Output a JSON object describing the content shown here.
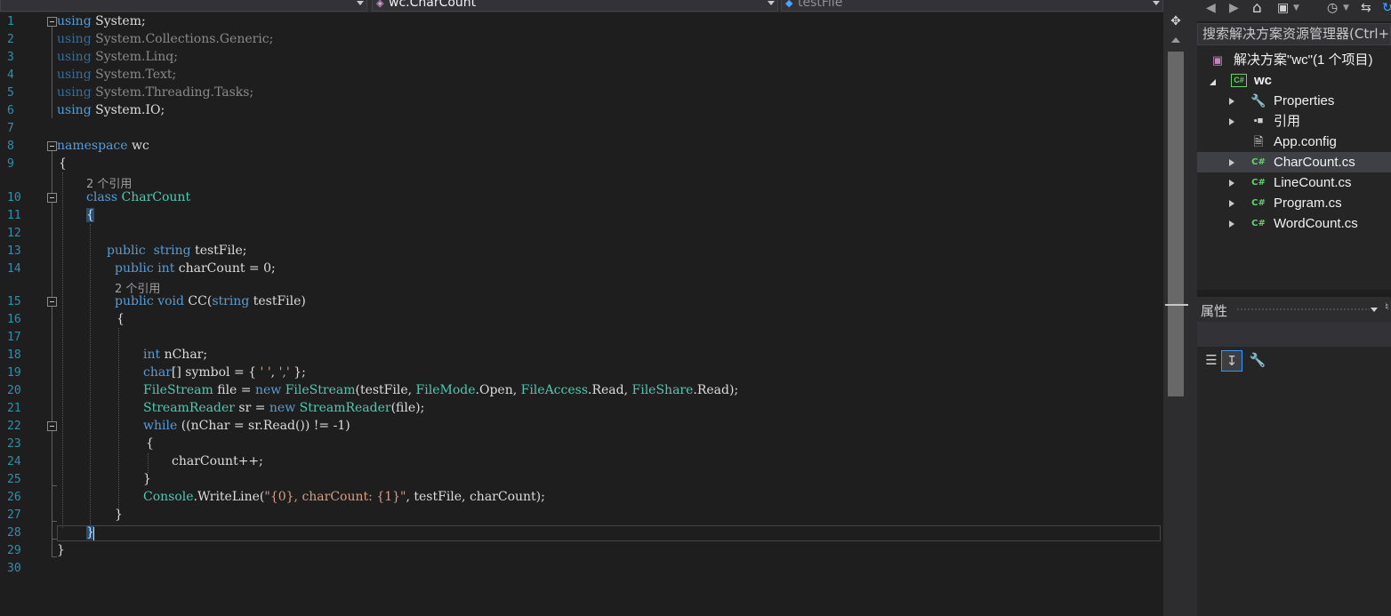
{
  "nav": {
    "project_dropdown": "",
    "class_dropdown": "wc.CharCount",
    "member_dropdown": "testFile"
  },
  "code_lines": [
    {
      "n": "1",
      "text": "using System;"
    },
    {
      "n": "2",
      "text": "using System.Collections.Generic;"
    },
    {
      "n": "3",
      "text": "using System.Linq;"
    },
    {
      "n": "4",
      "text": "using System.Text;"
    },
    {
      "n": "5",
      "text": "using System.Threading.Tasks;"
    },
    {
      "n": "6",
      "text": "using System.IO;"
    },
    {
      "n": "7",
      "text": ""
    },
    {
      "n": "8",
      "text": "namespace wc"
    },
    {
      "n": "9",
      "text": "{"
    },
    {
      "n": "10",
      "text": "class CharCount"
    },
    {
      "n": "11",
      "text": "{"
    },
    {
      "n": "12",
      "text": ""
    },
    {
      "n": "13",
      "text": "public  string testFile;"
    },
    {
      "n": "14",
      "text": "public int charCount = 0;"
    },
    {
      "n": "15",
      "text": "public void CC(string testFile)"
    },
    {
      "n": "16",
      "text": "{"
    },
    {
      "n": "17",
      "text": ""
    },
    {
      "n": "18",
      "text": "int nChar;"
    },
    {
      "n": "19",
      "text": "char[] symbol = { ' ', ',' };"
    },
    {
      "n": "20",
      "text": "FileStream file = new FileStream(testFile, FileMode.Open, FileAccess.Read, FileShare.Read);"
    },
    {
      "n": "21",
      "text": "StreamReader sr = new StreamReader(file);"
    },
    {
      "n": "22",
      "text": "while ((nChar = sr.Read()) != -1)"
    },
    {
      "n": "23",
      "text": "{"
    },
    {
      "n": "24",
      "text": "charCount++;"
    },
    {
      "n": "25",
      "text": "}"
    },
    {
      "n": "26",
      "text": "Console.WriteLine(\"{0}, charCount: {1}\", testFile, charCount);"
    },
    {
      "n": "27",
      "text": "}"
    },
    {
      "n": "28",
      "text": "}"
    },
    {
      "n": "29",
      "text": "}"
    },
    {
      "n": "30",
      "text": ""
    }
  ],
  "codelens": {
    "class_refs": "2 个引用",
    "method_refs": "2 个引用"
  },
  "solution_explorer": {
    "search_placeholder": "搜索解决方案资源管理器(Ctrl+",
    "solution_label": "解决方案\"wc\"(1 个项目)",
    "project_label": "wc",
    "project_icon_text": "C#",
    "cs_icon_text": "C#",
    "items": [
      {
        "label": "Properties",
        "icon": "wrench-icon"
      },
      {
        "label": "引用",
        "icon": "references-icon"
      },
      {
        "label": "App.config",
        "icon": "config-file-icon"
      },
      {
        "label": "CharCount.cs",
        "icon": "csharp-file-icon",
        "selected": true
      },
      {
        "label": "LineCount.cs",
        "icon": "csharp-file-icon"
      },
      {
        "label": "Program.cs",
        "icon": "csharp-file-icon"
      },
      {
        "label": "WordCount.cs",
        "icon": "csharp-file-icon"
      }
    ]
  },
  "properties": {
    "title": "属性"
  },
  "colors": {
    "keyword": "#569cd6",
    "type": "#4ec9b0",
    "string": "#d69d85",
    "text": "#dcdcdc",
    "line_number": "#2b91af",
    "csharp_icon": "#64d464"
  }
}
